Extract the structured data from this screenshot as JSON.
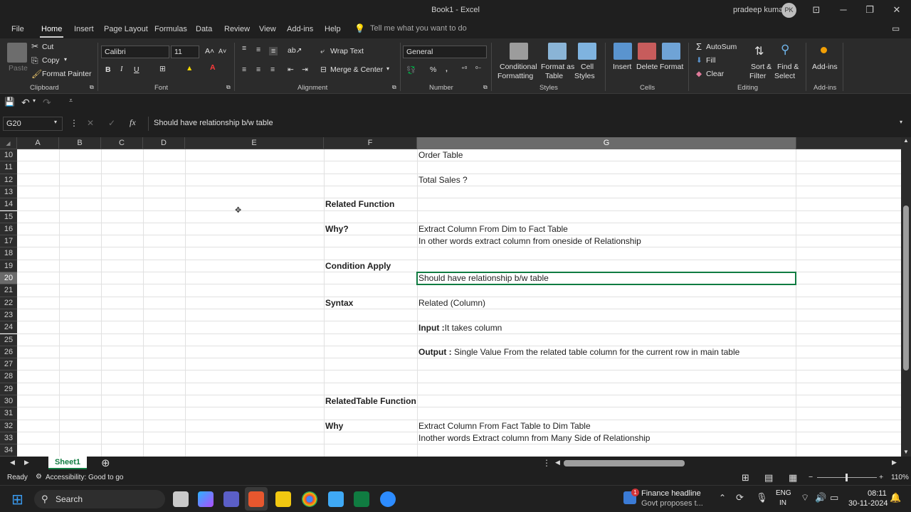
{
  "window": {
    "title": "Book1 - Excel",
    "user": "pradeep kumar",
    "initials": "PK"
  },
  "tabs": [
    "File",
    "Home",
    "Insert",
    "Page Layout",
    "Formulas",
    "Data",
    "Review",
    "View",
    "Add-ins",
    "Help"
  ],
  "tell_me": "Tell me what you want to do",
  "ribbon": {
    "clipboard": {
      "label": "Clipboard",
      "paste": "Paste",
      "cut": "Cut",
      "copy": "Copy",
      "format_painter": "Format Painter"
    },
    "font": {
      "label": "Font",
      "name": "Calibri",
      "size": "11",
      "bold": "B",
      "italic": "I",
      "underline": "U"
    },
    "alignment": {
      "label": "Alignment",
      "wrap": "Wrap Text",
      "merge": "Merge & Center"
    },
    "number": {
      "label": "Number",
      "format": "General"
    },
    "styles": {
      "label": "Styles",
      "cond1": "Conditional",
      "cond2": "Formatting",
      "fmt1": "Format as",
      "fmt2": "Table",
      "cell1": "Cell",
      "cell2": "Styles"
    },
    "cells": {
      "label": "Cells",
      "insert": "Insert",
      "delete": "Delete",
      "format": "Format"
    },
    "editing": {
      "label": "Editing",
      "autosum": "AutoSum",
      "fill": "Fill",
      "clear": "Clear",
      "sort1": "Sort &",
      "sort2": "Filter",
      "find1": "Find &",
      "find2": "Select"
    },
    "addins": {
      "label": "Add-ins",
      "btn": "Add-ins"
    }
  },
  "formula_bar": {
    "name_box": "G20",
    "fx": "fx",
    "content": "Should have relationship b/w table"
  },
  "columns": [
    "A",
    "B",
    "C",
    "D",
    "E",
    "F",
    "G"
  ],
  "rows": [
    "10",
    "11",
    "12",
    "13",
    "14",
    "15",
    "16",
    "17",
    "18",
    "19",
    "20",
    "21",
    "22",
    "23",
    "24",
    "25",
    "26",
    "27",
    "28",
    "29",
    "30",
    "31",
    "32",
    "33",
    "34"
  ],
  "cells": {
    "g10": "Order Table",
    "g12": "Total Sales ?",
    "f14": "Related  Function",
    "f16": "Why?",
    "g16": "Extract Column From Dim to Fact Table",
    "g17": "In other words extract column from oneside of Relationship",
    "f19": "Condition Apply",
    "g20": "Should have relationship b/w table",
    "f22": "Syntax",
    "g22": "Related (Column)",
    "g24_b": "Input :",
    "g24": "It takes column",
    "g26_b": "Output :",
    "g26": " Single Value From the related table column for the current row in main table",
    "f30": "RelatedTable Function",
    "f32": "Why",
    "g32": "Extract Column From Fact Table to Dim Table",
    "g33": "Inother words Extract column from Many Side of Relationship"
  },
  "sheet": {
    "name": "Sheet1"
  },
  "status": {
    "ready": "Ready",
    "accessibility": "Accessibility: Good to go",
    "zoom": "110%"
  },
  "taskbar": {
    "search": "Search",
    "news_title": "Finance headline",
    "news_sub": "Govt proposes t...",
    "lang1": "ENG",
    "lang2": "IN",
    "time": "08:11",
    "date": "30-11-2024"
  }
}
